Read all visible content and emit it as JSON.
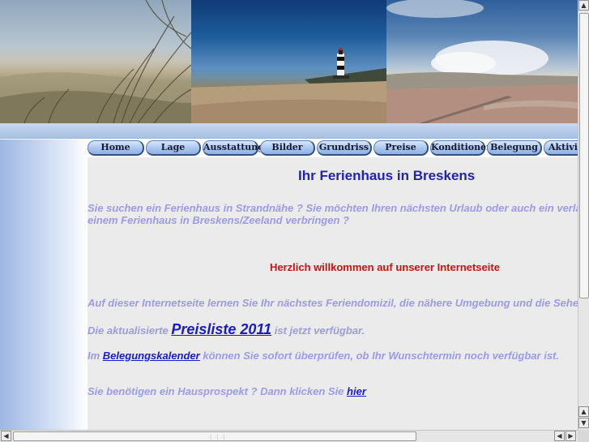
{
  "banner": {
    "photos": [
      "dunes-photo",
      "lighthouse-photo",
      "beach-photo"
    ]
  },
  "nav": {
    "items": [
      {
        "label": "Home"
      },
      {
        "label": "Lage"
      },
      {
        "label": "Ausstattung"
      },
      {
        "label": "Bilder"
      },
      {
        "label": "Grundriss"
      },
      {
        "label": "Preise"
      },
      {
        "label": "Konditionen"
      },
      {
        "label": "Belegung"
      },
      {
        "label": "Aktivitäten"
      }
    ]
  },
  "main": {
    "title": "Ihr Ferienhaus in Breskens",
    "intro_line1": "Sie suchen ein Ferienhaus in Strandnähe ? Sie möchten Ihren nächsten Urlaub oder auch ein verlängertes Wochenende in",
    "intro_line2": "einem Ferienhaus in Breskens/Zeeland verbringen ?",
    "welcome": "Herzlich willkommen auf unserer Internetseite",
    "site_info": "Auf dieser Internetseite lernen Sie Ihr nächstes Feriendomizil, die nähere Umgebung und die Sehenswürdigkeiten kennen.",
    "price_prefix": "Die aktualisierte",
    "price_link": "Preisliste 2011",
    "price_suffix": "ist jetzt verfügbar.",
    "calendar_prefix": "Im",
    "calendar_link": "Belegungskalender",
    "calendar_suffix": "können Sie sofort überprüfen, ob Ihr Wunschtermin noch verfügbar ist.",
    "prospect_text": "Sie benötigen ein Hausprospekt ? Dann klicken Sie",
    "prospect_link": "hier"
  },
  "colors": {
    "title": "#2222b2",
    "intro": "#9b9be8",
    "welcome": "#cc1111",
    "link": "#1a1acc",
    "content_bg": "#ebebeb",
    "nav_button": "#a9c6f0"
  },
  "scrollbars": {
    "up_icon": "arrow-up-icon",
    "down_icon": "arrow-down-icon",
    "left_icon": "arrow-left-icon",
    "right_icon": "arrow-right-icon"
  }
}
